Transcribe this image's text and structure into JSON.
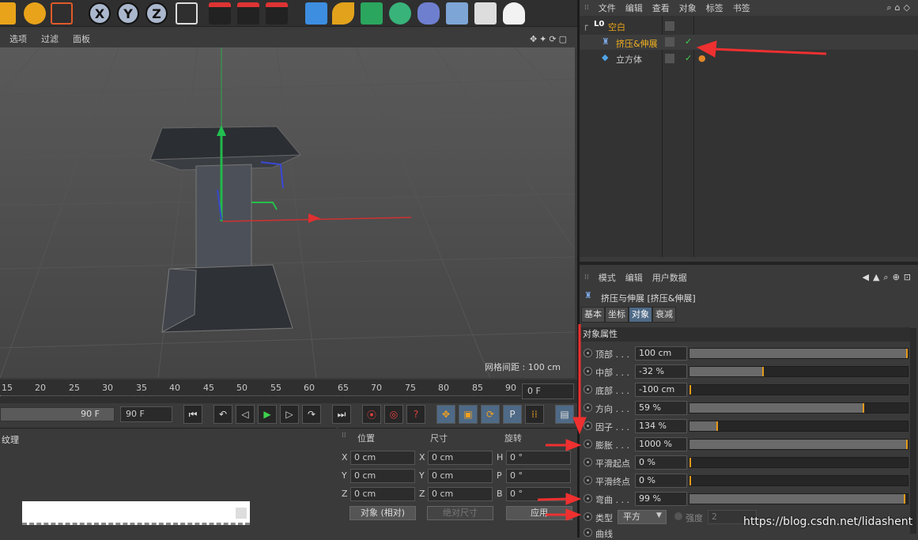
{
  "toolbar": {
    "axis_buttons": [
      "X",
      "Y",
      "Z"
    ]
  },
  "viewport": {
    "menu": [
      "选项",
      "过滤",
      "面板"
    ],
    "grid_info": "网格间距 : 100 cm"
  },
  "timeline": {
    "ticks": [
      "15",
      "20",
      "25",
      "30",
      "35",
      "40",
      "45",
      "50",
      "55",
      "60",
      "65",
      "70",
      "75",
      "80",
      "85",
      "90"
    ],
    "current_frame": "0 F",
    "range_end_a": "90 F",
    "range_end_b": "90 F"
  },
  "material": {
    "tab_label": "纹理"
  },
  "coords": {
    "headers": {
      "position": "位置",
      "size": "尺寸",
      "rotation": "旋转"
    },
    "rows": [
      {
        "pos_label": "X",
        "pos_val": "0 cm",
        "size_label": "X",
        "size_val": "0 cm",
        "rot_label": "H",
        "rot_val": "0 °"
      },
      {
        "pos_label": "Y",
        "pos_val": "0 cm",
        "size_label": "Y",
        "size_val": "0 cm",
        "rot_label": "P",
        "rot_val": "0 °"
      },
      {
        "pos_label": "Z",
        "pos_val": "0 cm",
        "size_label": "Z",
        "size_val": "0 cm",
        "rot_label": "B",
        "rot_val": "0 °"
      }
    ],
    "mode_select": "对象 (相对)",
    "size_mode": "绝对尺寸",
    "apply": "应用"
  },
  "object_manager": {
    "menu": [
      "文件",
      "编辑",
      "查看",
      "对象",
      "标签",
      "书签"
    ],
    "objects": [
      {
        "name": "空白",
        "layer": "L0"
      },
      {
        "name": "挤压&伸展"
      },
      {
        "name": "立方体"
      }
    ]
  },
  "attributes": {
    "menu": [
      "模式",
      "编辑",
      "用户数据"
    ],
    "title": "挤压与伸展 [挤压&伸展]",
    "tabs": [
      "基本",
      "坐标",
      "对象",
      "衰减"
    ],
    "section": "对象属性",
    "params": [
      {
        "label": "顶部 . . .",
        "value": "100 cm",
        "fill": 1.0
      },
      {
        "label": "中部 . . .",
        "value": "-32 %",
        "fill": 0.34
      },
      {
        "label": "底部 . . .",
        "value": "-100 cm",
        "fill": 0.0
      },
      {
        "label": "方向 . . .",
        "value": "59 %",
        "fill": 0.8
      },
      {
        "label": "因子 . . .",
        "value": "134 %",
        "fill": 0.13
      },
      {
        "label": "膨胀 . . .",
        "value": "1000 %",
        "fill": 1.0
      },
      {
        "label": "平滑起点",
        "value": "0 %",
        "fill": 0.0
      },
      {
        "label": "平滑终点",
        "value": "0 %",
        "fill": 0.0
      },
      {
        "label": "弯曲 . . .",
        "value": "99 %",
        "fill": 0.99
      }
    ],
    "type_label": "类型",
    "type_value": "平方",
    "strength_label": "强度",
    "strength_value": "2",
    "curve_label": "曲线"
  },
  "watermark": "https://blog.csdn.net/lidashent"
}
